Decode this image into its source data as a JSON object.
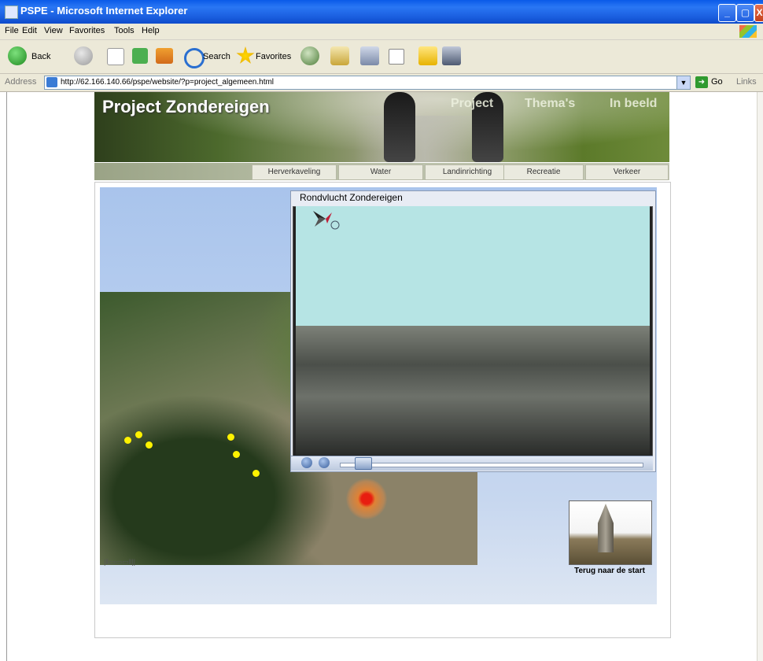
{
  "window": {
    "title": "PSPE - Microsoft Internet Explorer",
    "minimize": "_",
    "maximize": "▢",
    "close": "X"
  },
  "menu": [
    "File",
    "Edit",
    "View",
    "Favorites",
    "Tools",
    "Help"
  ],
  "toolbar": {
    "back_label": "Back",
    "search_label": "Search",
    "favorites_label": "Favorites"
  },
  "address": {
    "label": "Address",
    "url": "http://62.166.140.66/pspe/website/?p=project_algemeen.html",
    "go_label": "Go",
    "links_label": "Links"
  },
  "site": {
    "title": "Project Zondereigen",
    "top_nav": [
      "Project",
      "Thema's",
      "In beeld"
    ],
    "sub_nav": [
      "Herverkaveling",
      "Water",
      "Landinrichting",
      "Recreatie",
      "Verkeer"
    ]
  },
  "video": {
    "title": "Rondvlucht Zondereigen",
    "progress": 0.05
  },
  "thumbnail": {
    "caption": "Terug naar de start"
  },
  "colors": {
    "titlebar": "#0a5ae8",
    "marker": "#fff200",
    "hotspot": "#e81e10"
  }
}
